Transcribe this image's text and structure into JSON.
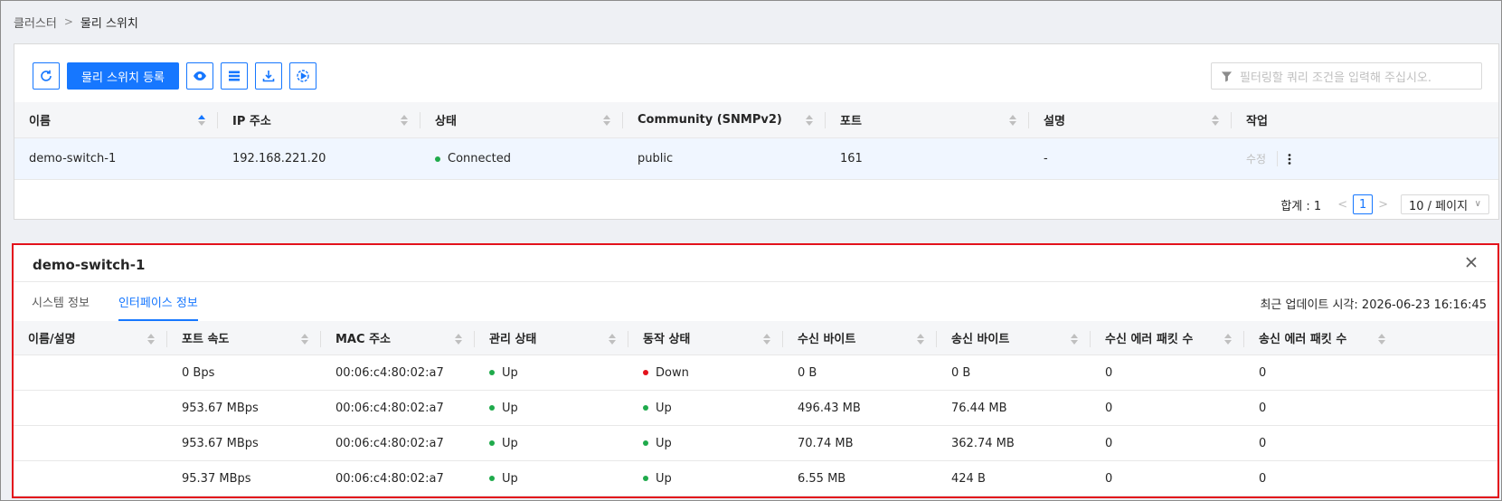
{
  "breadcrumb": {
    "parent": "클러스터",
    "separator": ">",
    "current": "물리 스위치"
  },
  "toolbar": {
    "register_label": "물리 스위치 등록",
    "filter_placeholder": "필터링할 쿼리 조건을 입력해 주십시오."
  },
  "switch_table": {
    "columns": [
      "이름",
      "IP 주소",
      "상태",
      "Community (SNMPv2)",
      "포트",
      "설명",
      "작업"
    ],
    "rows": [
      {
        "name": "demo-switch-1",
        "ip": "192.168.221.20",
        "status": "Connected",
        "community": "public",
        "port": "161",
        "description": "-",
        "action": "수정"
      }
    ]
  },
  "pagination": {
    "total": "합계 : 1",
    "prev": "<",
    "page": "1",
    "next": ">",
    "page_size": "10 / 페이지"
  },
  "detail": {
    "title": "demo-switch-1",
    "tabs": [
      "시스템 정보",
      "인터페이스 정보"
    ],
    "active_tab": 1,
    "updated": "최근 업데이트 시각: 2026-06-23 16:16:45",
    "columns": [
      "이름/설명",
      "포트 속도",
      "MAC 주소",
      "관리 상태",
      "동작 상태",
      "수신 바이트",
      "송신 바이트",
      "수신 에러 패킷 수",
      "송신 에러 패킷 수"
    ],
    "rows": [
      {
        "name": "",
        "speed": "0 Bps",
        "mac": "00:06:c4:80:02:a7",
        "admin": "Up",
        "oper": "Down",
        "rx": "0 B",
        "tx": "0 B",
        "rx_err": "0",
        "tx_err": "0"
      },
      {
        "name": "",
        "speed": "953.67 MBps",
        "mac": "00:06:c4:80:02:a7",
        "admin": "Up",
        "oper": "Up",
        "rx": "496.43 MB",
        "tx": "76.44 MB",
        "rx_err": "0",
        "tx_err": "0"
      },
      {
        "name": "",
        "speed": "953.67 MBps",
        "mac": "00:06:c4:80:02:a7",
        "admin": "Up",
        "oper": "Up",
        "rx": "70.74 MB",
        "tx": "362.74 MB",
        "rx_err": "0",
        "tx_err": "0"
      },
      {
        "name": "",
        "speed": "95.37 MBps",
        "mac": "00:06:c4:80:02:a7",
        "admin": "Up",
        "oper": "Up",
        "rx": "6.55 MB",
        "tx": "424 B",
        "rx_err": "0",
        "tx_err": "0"
      }
    ]
  },
  "colors": {
    "primary": "#1677ff",
    "up": "#1faa4b",
    "down": "#e3121c",
    "highlight": "#e3121c"
  },
  "icons": [
    "refresh-icon",
    "eye-icon",
    "list-icon",
    "download-icon",
    "play-circle-icon",
    "filter-icon",
    "close-icon",
    "more-vertical-icon"
  ]
}
